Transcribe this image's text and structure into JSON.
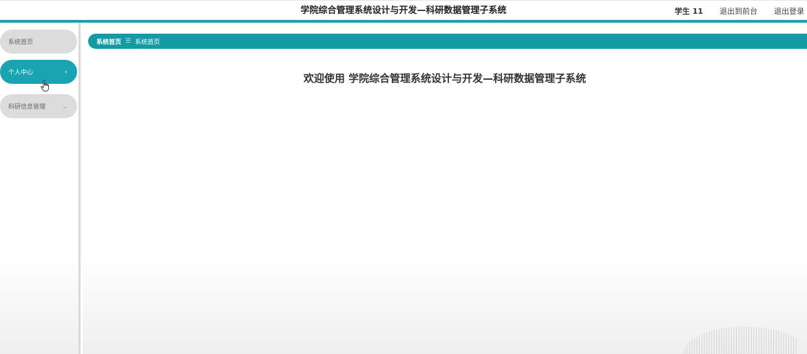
{
  "header": {
    "title": "学院综合管理系统设计与开发—科研数据管理子系统",
    "user": "学生 11",
    "back_to_front": "退出到前台",
    "logout": "退出登录"
  },
  "sidebar": {
    "items": [
      {
        "label": "系统首页"
      },
      {
        "label": "个人中心",
        "chevron": "‹"
      },
      {
        "label": "科研信息管理",
        "chevron": "⌄"
      }
    ]
  },
  "breadcrumb": {
    "home": "系统首页",
    "separator": "☰",
    "current": "系统首页"
  },
  "main": {
    "welcome": "欢迎使用 学院综合管理系统设计与开发—科研数据管理子系统"
  },
  "colors": {
    "accent": "#17a2ab",
    "active_menu": "#1aa3b0",
    "menu_bg": "#dcdcdc"
  }
}
